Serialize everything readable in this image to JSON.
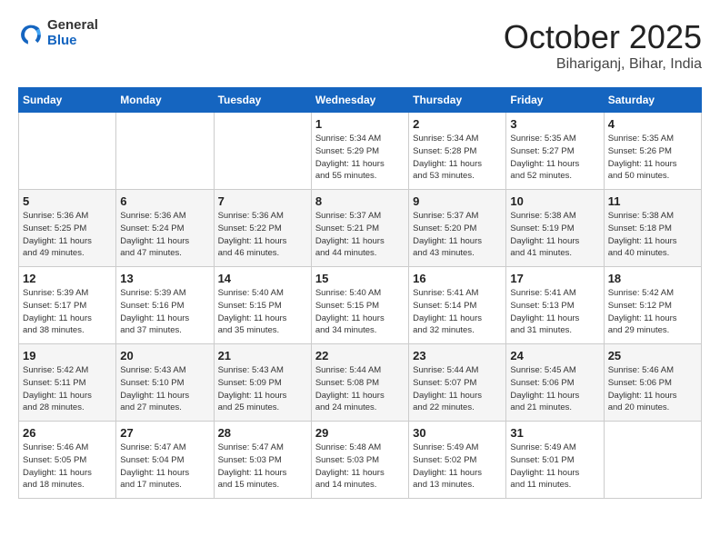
{
  "header": {
    "logo_general": "General",
    "logo_blue": "Blue",
    "month": "October 2025",
    "location": "Bihariganj, Bihar, India"
  },
  "weekdays": [
    "Sunday",
    "Monday",
    "Tuesday",
    "Wednesday",
    "Thursday",
    "Friday",
    "Saturday"
  ],
  "weeks": [
    [
      {
        "day": "",
        "info": ""
      },
      {
        "day": "",
        "info": ""
      },
      {
        "day": "",
        "info": ""
      },
      {
        "day": "1",
        "info": "Sunrise: 5:34 AM\nSunset: 5:29 PM\nDaylight: 11 hours\nand 55 minutes."
      },
      {
        "day": "2",
        "info": "Sunrise: 5:34 AM\nSunset: 5:28 PM\nDaylight: 11 hours\nand 53 minutes."
      },
      {
        "day": "3",
        "info": "Sunrise: 5:35 AM\nSunset: 5:27 PM\nDaylight: 11 hours\nand 52 minutes."
      },
      {
        "day": "4",
        "info": "Sunrise: 5:35 AM\nSunset: 5:26 PM\nDaylight: 11 hours\nand 50 minutes."
      }
    ],
    [
      {
        "day": "5",
        "info": "Sunrise: 5:36 AM\nSunset: 5:25 PM\nDaylight: 11 hours\nand 49 minutes."
      },
      {
        "day": "6",
        "info": "Sunrise: 5:36 AM\nSunset: 5:24 PM\nDaylight: 11 hours\nand 47 minutes."
      },
      {
        "day": "7",
        "info": "Sunrise: 5:36 AM\nSunset: 5:22 PM\nDaylight: 11 hours\nand 46 minutes."
      },
      {
        "day": "8",
        "info": "Sunrise: 5:37 AM\nSunset: 5:21 PM\nDaylight: 11 hours\nand 44 minutes."
      },
      {
        "day": "9",
        "info": "Sunrise: 5:37 AM\nSunset: 5:20 PM\nDaylight: 11 hours\nand 43 minutes."
      },
      {
        "day": "10",
        "info": "Sunrise: 5:38 AM\nSunset: 5:19 PM\nDaylight: 11 hours\nand 41 minutes."
      },
      {
        "day": "11",
        "info": "Sunrise: 5:38 AM\nSunset: 5:18 PM\nDaylight: 11 hours\nand 40 minutes."
      }
    ],
    [
      {
        "day": "12",
        "info": "Sunrise: 5:39 AM\nSunset: 5:17 PM\nDaylight: 11 hours\nand 38 minutes."
      },
      {
        "day": "13",
        "info": "Sunrise: 5:39 AM\nSunset: 5:16 PM\nDaylight: 11 hours\nand 37 minutes."
      },
      {
        "day": "14",
        "info": "Sunrise: 5:40 AM\nSunset: 5:15 PM\nDaylight: 11 hours\nand 35 minutes."
      },
      {
        "day": "15",
        "info": "Sunrise: 5:40 AM\nSunset: 5:15 PM\nDaylight: 11 hours\nand 34 minutes."
      },
      {
        "day": "16",
        "info": "Sunrise: 5:41 AM\nSunset: 5:14 PM\nDaylight: 11 hours\nand 32 minutes."
      },
      {
        "day": "17",
        "info": "Sunrise: 5:41 AM\nSunset: 5:13 PM\nDaylight: 11 hours\nand 31 minutes."
      },
      {
        "day": "18",
        "info": "Sunrise: 5:42 AM\nSunset: 5:12 PM\nDaylight: 11 hours\nand 29 minutes."
      }
    ],
    [
      {
        "day": "19",
        "info": "Sunrise: 5:42 AM\nSunset: 5:11 PM\nDaylight: 11 hours\nand 28 minutes."
      },
      {
        "day": "20",
        "info": "Sunrise: 5:43 AM\nSunset: 5:10 PM\nDaylight: 11 hours\nand 27 minutes."
      },
      {
        "day": "21",
        "info": "Sunrise: 5:43 AM\nSunset: 5:09 PM\nDaylight: 11 hours\nand 25 minutes."
      },
      {
        "day": "22",
        "info": "Sunrise: 5:44 AM\nSunset: 5:08 PM\nDaylight: 11 hours\nand 24 minutes."
      },
      {
        "day": "23",
        "info": "Sunrise: 5:44 AM\nSunset: 5:07 PM\nDaylight: 11 hours\nand 22 minutes."
      },
      {
        "day": "24",
        "info": "Sunrise: 5:45 AM\nSunset: 5:06 PM\nDaylight: 11 hours\nand 21 minutes."
      },
      {
        "day": "25",
        "info": "Sunrise: 5:46 AM\nSunset: 5:06 PM\nDaylight: 11 hours\nand 20 minutes."
      }
    ],
    [
      {
        "day": "26",
        "info": "Sunrise: 5:46 AM\nSunset: 5:05 PM\nDaylight: 11 hours\nand 18 minutes."
      },
      {
        "day": "27",
        "info": "Sunrise: 5:47 AM\nSunset: 5:04 PM\nDaylight: 11 hours\nand 17 minutes."
      },
      {
        "day": "28",
        "info": "Sunrise: 5:47 AM\nSunset: 5:03 PM\nDaylight: 11 hours\nand 15 minutes."
      },
      {
        "day": "29",
        "info": "Sunrise: 5:48 AM\nSunset: 5:03 PM\nDaylight: 11 hours\nand 14 minutes."
      },
      {
        "day": "30",
        "info": "Sunrise: 5:49 AM\nSunset: 5:02 PM\nDaylight: 11 hours\nand 13 minutes."
      },
      {
        "day": "31",
        "info": "Sunrise: 5:49 AM\nSunset: 5:01 PM\nDaylight: 11 hours\nand 11 minutes."
      },
      {
        "day": "",
        "info": ""
      }
    ]
  ]
}
